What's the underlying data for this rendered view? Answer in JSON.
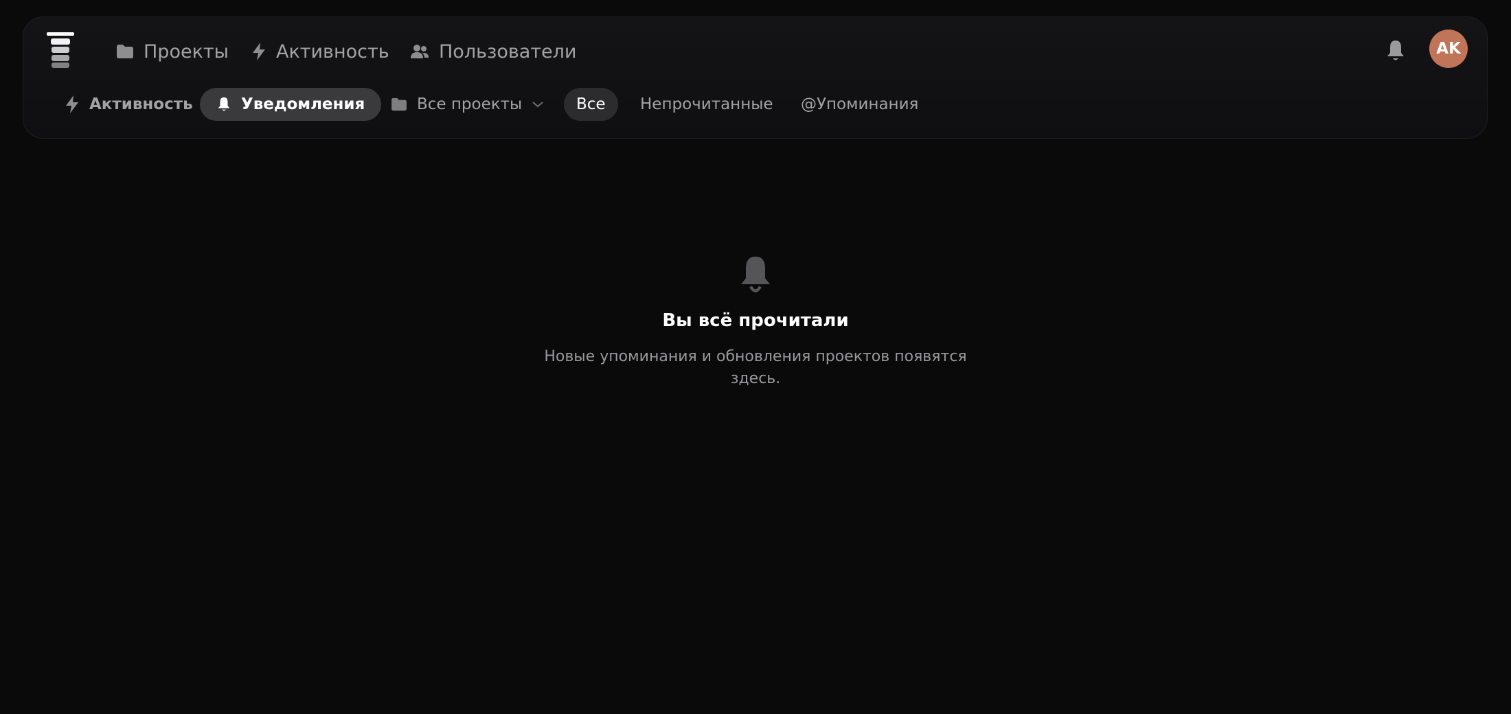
{
  "header": {
    "nav": [
      {
        "label": "Проекты",
        "icon": "folder-icon"
      },
      {
        "label": "Активность",
        "icon": "bolt-icon"
      },
      {
        "label": "Пользователи",
        "icon": "users-icon"
      }
    ],
    "avatar_initials": "AK",
    "avatar_color": "#c07458"
  },
  "toolbar": {
    "views": [
      {
        "label": "Активность",
        "icon": "bolt-icon",
        "active": false
      },
      {
        "label": "Уведомления",
        "icon": "bell-icon",
        "active": true
      }
    ],
    "project_filter": {
      "label": "Все проекты",
      "icon": "folder-icon"
    },
    "filters": [
      {
        "label": "Все",
        "active": true
      },
      {
        "label": "Непрочитанные",
        "active": false
      },
      {
        "label": "@Упоминания",
        "active": false
      }
    ]
  },
  "empty_state": {
    "icon": "bell-icon",
    "title": "Вы всё прочитали",
    "subtitle": "Новые упоминания и обновления проектов появятся здесь."
  },
  "colors": {
    "background": "#0a0a0a",
    "active_pill": "#3a3a3c",
    "text_muted": "#a3a3a6"
  }
}
